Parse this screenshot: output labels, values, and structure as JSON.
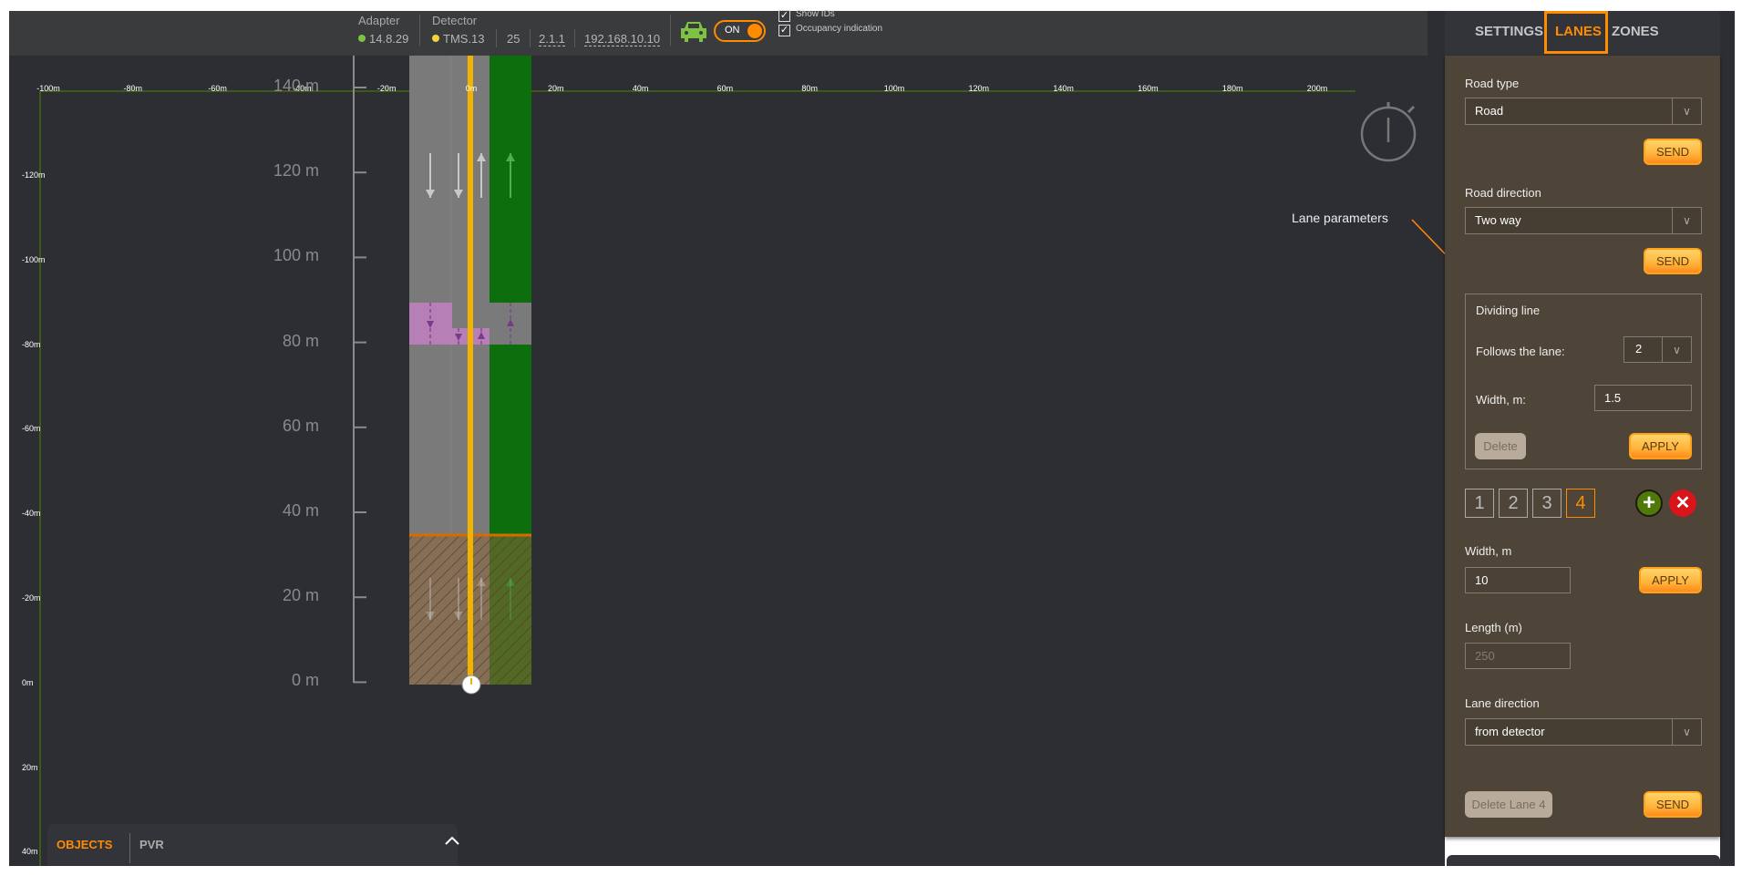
{
  "header": {
    "adapter_label": "Adapter",
    "adapter_version": "14.8.29",
    "adapter_status_color": "#7dc242",
    "detector_label": "Detector",
    "detector_name": "TMS.13",
    "detector_status_color": "#f5d33a",
    "detector_number": "25",
    "firmware": "2.1.1",
    "ip": "192.168.10.10",
    "toggle_label": "ON",
    "toggle_on": true,
    "show_ids_label": "Show IDs",
    "show_ids_checked": true,
    "occupancy_label": "Occupancy indication",
    "occupancy_checked": true
  },
  "map": {
    "x_axis_labels": [
      "-100m",
      "-80m",
      "-60m",
      "-40m",
      "-20m",
      "0m",
      "20m",
      "40m",
      "60m",
      "80m",
      "100m",
      "120m",
      "140m",
      "160m",
      "180m",
      "200m"
    ],
    "y_axis_labels": [
      "-120m",
      "-100m",
      "-80m",
      "-60m",
      "-40m",
      "-20m",
      "0m",
      "20m",
      "40m"
    ],
    "meter_scale_labels": [
      "140 m",
      "120 m",
      "100 m",
      "80 m",
      "60 m",
      "40 m",
      "20 m",
      "0 m"
    ],
    "annotation": "Lane parameters",
    "colors": {
      "road": "#7a7a7a",
      "lane_selected": "#0c6e0c",
      "divider": "#f0b400",
      "zone": "#b67fb6",
      "accent": "#ff8c00"
    }
  },
  "bottom_panel": {
    "tabs": [
      "OBJECTS",
      "PVR"
    ],
    "active_tab": "OBJECTS"
  },
  "sidebar": {
    "tabs": [
      "SETTINGS",
      "LANES",
      "ZONES"
    ],
    "active_tab": "LANES",
    "road_type_label": "Road type",
    "road_type_value": "Road",
    "send_label": "SEND",
    "road_direction_label": "Road direction",
    "road_direction_value": "Two way",
    "dividing_line": {
      "title": "Dividing line",
      "follows_label": "Follows the lane:",
      "follows_value": "2",
      "width_label": "Width, m:",
      "width_value": "1.5",
      "delete_label": "Delete",
      "apply_label": "APPLY"
    },
    "lanes": [
      "1",
      "2",
      "3",
      "4"
    ],
    "selected_lane": "4",
    "width_label": "Width, m",
    "width_value": "10",
    "apply_label": "APPLY",
    "length_label": "Length (m)",
    "length_value": "250",
    "lane_direction_label": "Lane direction",
    "lane_direction_value": "from detector",
    "delete_lane_label": "Delete Lane 4"
  }
}
